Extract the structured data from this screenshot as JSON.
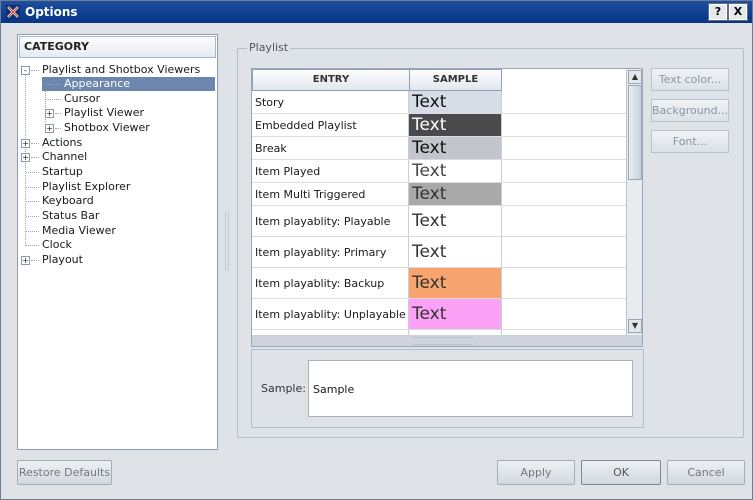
{
  "window": {
    "title": "Options",
    "help_label": "?",
    "close_label": "X"
  },
  "category": {
    "header": "CATEGORY",
    "items": [
      {
        "label": "Playlist and Shotbox Viewers",
        "expander": "-"
      },
      {
        "label": "Appearance"
      },
      {
        "label": "Cursor"
      },
      {
        "label": "Playlist Viewer",
        "expander": "+"
      },
      {
        "label": "Shotbox Viewer",
        "expander": "+"
      },
      {
        "label": "Actions",
        "expander": "+"
      },
      {
        "label": "Channel",
        "expander": "+"
      },
      {
        "label": "Startup"
      },
      {
        "label": "Playlist Explorer"
      },
      {
        "label": "Keyboard"
      },
      {
        "label": "Status Bar"
      },
      {
        "label": "Media Viewer"
      },
      {
        "label": "Clock"
      },
      {
        "label": "Playout",
        "expander": "+"
      }
    ]
  },
  "playlist": {
    "group_label": "Playlist",
    "columns": [
      "ENTRY",
      "SAMPLE"
    ],
    "rows": [
      {
        "entry": "Story",
        "sample": "Text",
        "bg": "#d6dde7",
        "fg": "#111111"
      },
      {
        "entry": "Embedded Playlist",
        "sample": "Text",
        "bg": "#4a4a4c",
        "fg": "#ffffff"
      },
      {
        "entry": "Break",
        "sample": "Text",
        "bg": "#c2c6cc",
        "fg": "#111111"
      },
      {
        "entry": "Item Played",
        "sample": "Text",
        "bg": "#ffffff",
        "fg": "#444444"
      },
      {
        "entry": "Item Multi Triggered",
        "sample": "Text",
        "bg": "#a9a9a9",
        "fg": "#333333"
      },
      {
        "entry": "Item playablity: Playable",
        "sample": "Text",
        "bg": "#ffffff",
        "fg": "#333333"
      },
      {
        "entry": "Item playablity: Primary",
        "sample": "Text",
        "bg": "#ffffff",
        "fg": "#333333"
      },
      {
        "entry": "Item playablity: Backup",
        "sample": "Text",
        "bg": "#f7a46f",
        "fg": "#333333"
      },
      {
        "entry": "Item playablity: Unplayable",
        "sample": "Text",
        "bg": "#fba2f7",
        "fg": "#333333"
      }
    ],
    "buttons": {
      "text_color": "Text color...",
      "background": "Background...",
      "font": "Font..."
    },
    "sample_label": "Sample:",
    "sample_value": "Sample"
  },
  "footer": {
    "restore": "Restore Defaults",
    "apply": "Apply",
    "ok": "OK",
    "cancel": "Cancel"
  },
  "colors": {
    "titlebar": "#0c3e90",
    "selection": "#6b87ad",
    "dialog_bg": "#dfe3e8"
  }
}
